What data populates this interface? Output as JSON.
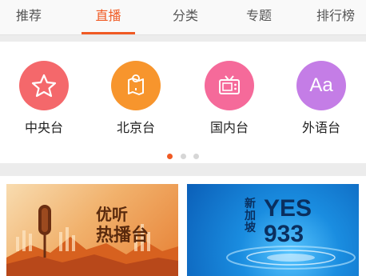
{
  "tabs": [
    {
      "label": "推荐",
      "active": false
    },
    {
      "label": "直播",
      "active": true
    },
    {
      "label": "分类",
      "active": false
    },
    {
      "label": "专题",
      "active": false
    },
    {
      "label": "排行榜",
      "active": false
    }
  ],
  "stations": [
    {
      "label": "中央台",
      "icon": "star-icon",
      "color": "#f4686b"
    },
    {
      "label": "北京台",
      "icon": "map-pin-icon",
      "color": "#f7952d"
    },
    {
      "label": "国内台",
      "icon": "tv-icon",
      "color": "#f56a9a"
    },
    {
      "label": "外语台",
      "icon": "aa-icon",
      "color": "#c47de6"
    }
  ],
  "station_icon_text": {
    "aa": "Aa"
  },
  "carousel": {
    "page_index": 1,
    "page_count": 3
  },
  "banners": [
    {
      "name": "youting-rebotai",
      "line1": "优听",
      "line2": "热播台"
    },
    {
      "name": "yes933",
      "side_text": "新加坡",
      "main_text": "YES",
      "number": "933"
    }
  ],
  "colors": {
    "accent": "#f05a24"
  }
}
